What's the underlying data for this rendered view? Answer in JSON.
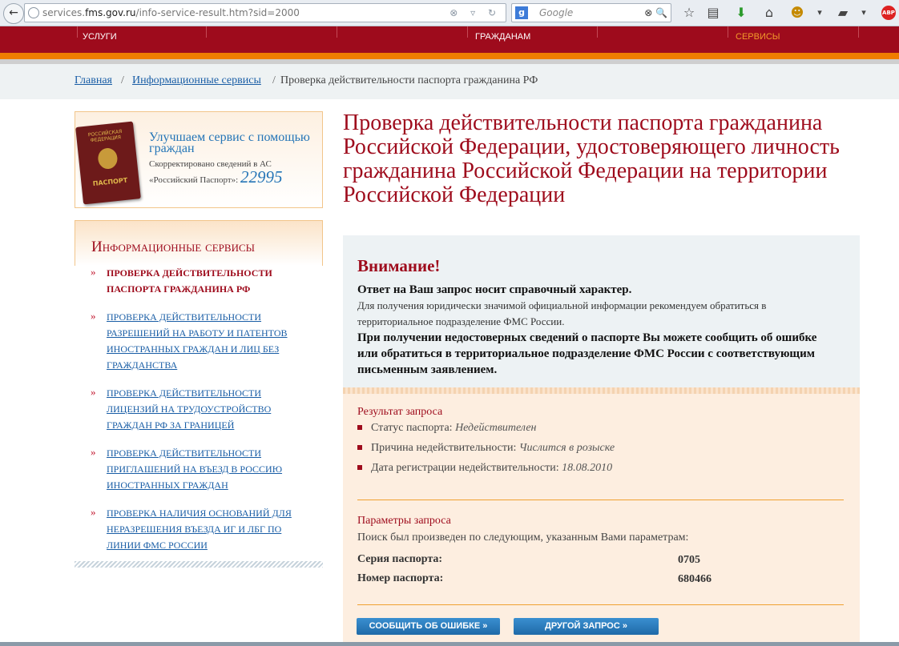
{
  "browser": {
    "back_icon": "←",
    "url_prefix": "services.",
    "url_domain": "fms.gov.ru",
    "url_path": "/info-service-result.htm?sid=2000",
    "url_buttons": "⊗ ▿ ↻",
    "search_engine": "g",
    "search_placeholder": "Google",
    "search_buttons": "⊗ 🔍",
    "icons": [
      "☆",
      "▤",
      "⬇",
      "⌂",
      "☻",
      "▾",
      "▰",
      "▾"
    ],
    "abp_label": "ABP"
  },
  "nav": {
    "items": [
      "УСЛУГИ",
      "ГРАЖДАНАМ",
      "СЕРВИСЫ"
    ],
    "active_color": "#f29a2b"
  },
  "breadcrumb": {
    "home": "Главная",
    "section": "Информационные сервисы",
    "sep": "/",
    "current": "Проверка действительности паспорта гражданина РФ"
  },
  "promo": {
    "passport_top": "РОССИЙСКАЯ ФЕДЕРАЦИЯ",
    "passport_name": "ПАСПОРТ",
    "title": "Улучшаем сервис с помощью граждан",
    "text": "Скорректировано сведений в АС «Российский Паспорт»:",
    "count": "22995"
  },
  "sidebar": {
    "title": "Информационные сервисы",
    "bullet": "»",
    "items": [
      "Проверка действительности паспорта гражданина РФ",
      "Проверка действительности разрешений на работу и патентов иностранных граждан и лиц без гражданства",
      "Проверка действительности лицензий на трудоустройство граждан РФ за границей",
      "Проверка действительности приглашений на въезд в Россию иностранных граждан",
      "Проверка наличия оснований для неразрешения въезда ИГ и ЛБГ по линии ФМС России"
    ]
  },
  "main": {
    "title": "Проверка действительности паспорта гражданина Российской Федерации, удостоверяющего личность гражданина Российской Федерации на территории Российской Федерации",
    "warning_title": "Внимание!",
    "warning_line1": "Ответ на Ваш запрос носит справочный характер.",
    "warning_line2": "Для получения юридически значимой официальной информации рекомендуем обратиться в территориальное подразделение ФМС России.",
    "warning_line3": "При получении недостоверных сведений о паспорте Вы можете сообщить об ошибке или обратиться в территориальное подразделение ФМС России с соответствующим письменным заявлением.",
    "result_title": "Результат запроса",
    "results": [
      {
        "label": "Статус паспорта:",
        "value": "Недействителен"
      },
      {
        "label": "Причина недействительности:",
        "value": "Числится в розыске"
      },
      {
        "label": "Дата регистрации недействительности:",
        "value": "18.08.2010"
      }
    ],
    "params_title": "Параметры запроса",
    "params_note": "Поиск был произведен по следующим, указанным Вами параметрам:",
    "series_label": "Серия паспорта:",
    "series_value": "0705",
    "number_label": "Номер паспорта:",
    "number_value": "680466",
    "report_button": "Сообщить об ошибке »",
    "new_request_button": "Другой запрос »"
  }
}
